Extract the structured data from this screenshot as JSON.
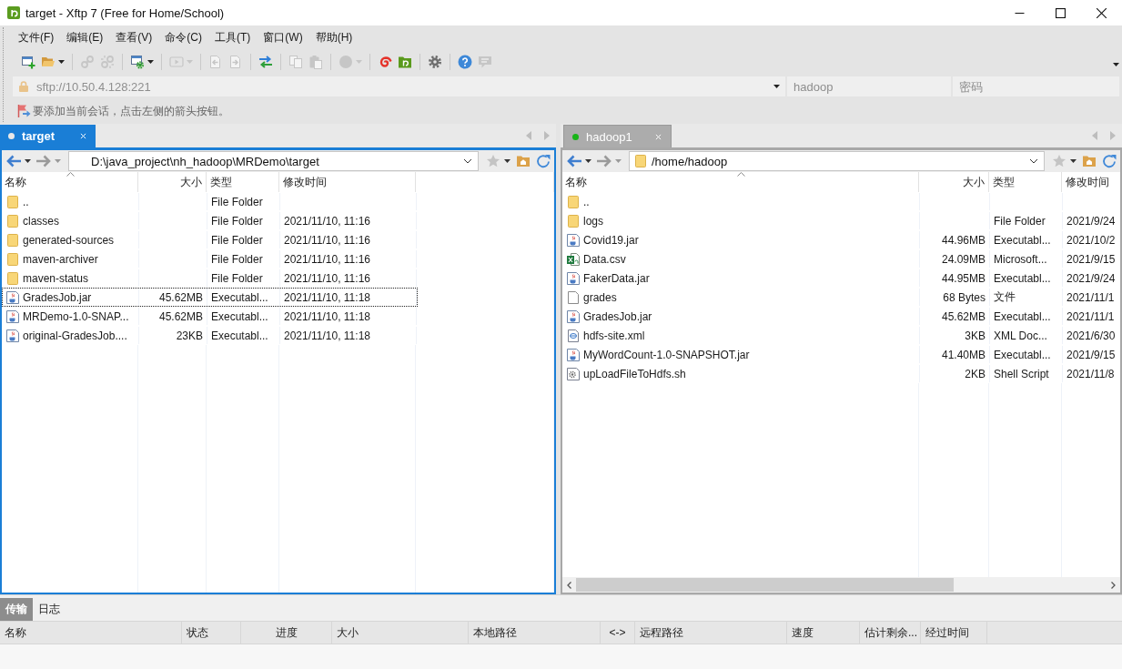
{
  "window": {
    "title": "target - Xftp 7 (Free for Home/School)"
  },
  "menu": [
    "文件(F)",
    "编辑(E)",
    "查看(V)",
    "命令(C)",
    "工具(T)",
    "窗口(W)",
    "帮助(H)"
  ],
  "toolbar": [
    [
      {
        "kind": "new-session",
        "disabled": false,
        "dropdown": false
      },
      {
        "kind": "open",
        "disabled": false,
        "dropdown": true
      }
    ],
    [
      {
        "kind": "connect",
        "disabled": true,
        "dropdown": false
      },
      {
        "kind": "disconnect",
        "disabled": true,
        "dropdown": false
      }
    ],
    [
      {
        "kind": "properties",
        "disabled": false,
        "dropdown": true
      }
    ],
    [
      {
        "kind": "play",
        "disabled": true,
        "dropdown": true
      }
    ],
    [
      {
        "kind": "upload",
        "disabled": true,
        "dropdown": false
      },
      {
        "kind": "download",
        "disabled": true,
        "dropdown": false
      }
    ],
    [
      {
        "kind": "transfer",
        "disabled": false,
        "dropdown": false
      }
    ],
    [
      {
        "kind": "copy",
        "disabled": true,
        "dropdown": false
      },
      {
        "kind": "paste",
        "disabled": true,
        "dropdown": false
      }
    ],
    [
      {
        "kind": "record",
        "disabled": true,
        "dropdown": true
      }
    ],
    [
      {
        "kind": "xshell",
        "disabled": false,
        "dropdown": false
      },
      {
        "kind": "xftp",
        "disabled": false,
        "dropdown": false
      }
    ],
    [
      {
        "kind": "settings",
        "disabled": false,
        "dropdown": false
      }
    ],
    [
      {
        "kind": "help",
        "disabled": false,
        "dropdown": false
      },
      {
        "kind": "chat",
        "disabled": true,
        "dropdown": false
      }
    ]
  ],
  "address": {
    "value": "sftp://10.50.4.128:221"
  },
  "username": {
    "value": "hadoop"
  },
  "password": {
    "placeholder": "密码"
  },
  "hint": "要添加当前会话，点击左侧的箭头按钮。",
  "panes": [
    {
      "kind": "local",
      "active": true,
      "tabs": [
        {
          "label": "target",
          "selected": true,
          "connected": false
        }
      ],
      "back": {
        "disabled": false
      },
      "forward": {
        "disabled": true
      },
      "path": "D:\\java_project\\nh_hadoop\\MRDemo\\target",
      "columns": [
        "名称",
        "大小",
        "类型",
        "修改时间"
      ],
      "rows": [
        {
          "kind": "folder",
          "name": "..",
          "type": "File Folder",
          "focused": false
        },
        {
          "kind": "folder",
          "name": "classes",
          "type": "File Folder",
          "modified": "2021/11/10, 11:16",
          "focused": false
        },
        {
          "kind": "folder",
          "name": "generated-sources",
          "type": "File Folder",
          "modified": "2021/11/10, 11:16",
          "focused": false
        },
        {
          "kind": "folder",
          "name": "maven-archiver",
          "type": "File Folder",
          "modified": "2021/11/10, 11:16",
          "focused": false
        },
        {
          "kind": "folder",
          "name": "maven-status",
          "type": "File Folder",
          "modified": "2021/11/10, 11:16",
          "focused": false
        },
        {
          "kind": "jar",
          "name": "GradesJob.jar",
          "size": "45.62MB",
          "type": "Executabl...",
          "modified": "2021/11/10, 11:18",
          "focused": true
        },
        {
          "kind": "jar",
          "name": "MRDemo-1.0-SNAP...",
          "size": "45.62MB",
          "type": "Executabl...",
          "modified": "2021/11/10, 11:18",
          "focused": false
        },
        {
          "kind": "jar",
          "name": "original-GradesJob....",
          "size": "23KB",
          "type": "Executabl...",
          "modified": "2021/11/10, 11:18",
          "focused": false
        }
      ]
    },
    {
      "kind": "remote",
      "active": false,
      "tabs": [
        {
          "label": "hadoop1",
          "selected": true,
          "connected": true
        }
      ],
      "back": {
        "disabled": false
      },
      "forward": {
        "disabled": true
      },
      "path": "/home/hadoop",
      "columns": [
        "名称",
        "大小",
        "类型",
        "修改时间"
      ],
      "rows": [
        {
          "kind": "folder",
          "name": "..",
          "focused": false
        },
        {
          "kind": "folder",
          "name": "logs",
          "type": "File Folder",
          "modified": "2021/9/24",
          "focused": false
        },
        {
          "kind": "jar",
          "name": "Covid19.jar",
          "size": "44.96MB",
          "type": "Executabl...",
          "modified": "2021/10/2",
          "focused": false
        },
        {
          "kind": "csv",
          "name": "Data.csv",
          "size": "24.09MB",
          "type": "Microsoft...",
          "modified": "2021/9/15",
          "focused": false
        },
        {
          "kind": "jar",
          "name": "FakerData.jar",
          "size": "44.95MB",
          "type": "Executabl...",
          "modified": "2021/9/24",
          "focused": false
        },
        {
          "kind": "file",
          "name": "grades",
          "size": "68 Bytes",
          "type": "文件",
          "modified": "2021/11/1",
          "focused": false
        },
        {
          "kind": "jar",
          "name": "GradesJob.jar",
          "size": "45.62MB",
          "type": "Executabl...",
          "modified": "2021/11/1",
          "focused": false
        },
        {
          "kind": "xml",
          "name": "hdfs-site.xml",
          "size": "3KB",
          "type": "XML Doc...",
          "modified": "2021/6/30",
          "focused": false
        },
        {
          "kind": "jar",
          "name": "MyWordCount-1.0-SNAPSHOT.jar",
          "size": "41.40MB",
          "type": "Executabl...",
          "modified": "2021/9/15",
          "focused": false
        },
        {
          "kind": "script",
          "name": "upLoadFileToHdfs.sh",
          "size": "2KB",
          "type": "Shell Script",
          "modified": "2021/11/8",
          "focused": false
        }
      ]
    }
  ],
  "transfer": {
    "tabs": [
      {
        "label": "传输",
        "selected": true
      },
      {
        "label": "日志",
        "selected": false
      }
    ],
    "columns": [
      "名称",
      "状态",
      "进度",
      "大小",
      "本地路径",
      "<->",
      "远程路径",
      "速度",
      "估计剩余...",
      "经过时间"
    ]
  }
}
